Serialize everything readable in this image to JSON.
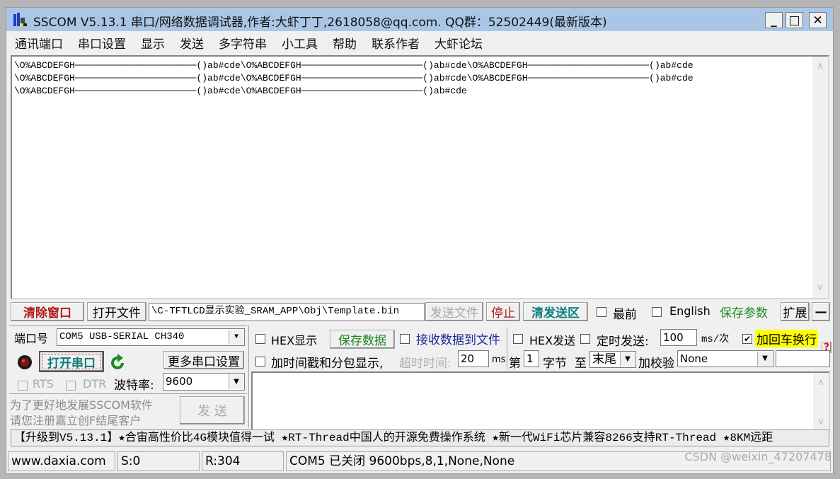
{
  "window": {
    "title": "SSCOM V5.13.1 串口/网络数据调试器,作者:大虾丁丁,2618058@qq.com. QQ群：52502449(最新版本)",
    "minimize_label": "_",
    "maximize_label": "□",
    "close_label": "✕"
  },
  "menu": {
    "items": [
      {
        "label": "通讯端口"
      },
      {
        "label": "串口设置"
      },
      {
        "label": "显示"
      },
      {
        "label": "发送"
      },
      {
        "label": "多字符串"
      },
      {
        "label": "小工具"
      },
      {
        "label": "帮助"
      },
      {
        "label": "联系作者"
      },
      {
        "label": "大虾论坛"
      }
    ]
  },
  "receive": {
    "lines": [
      "\\O%ABCDEFGH──────────────────────()ab#cde\\O%ABCDEFGH──────────────────────()ab#cde\\O%ABCDEFGH──────────────────────()ab#cde",
      "\\O%ABCDEFGH──────────────────────()ab#cde\\O%ABCDEFGH──────────────────────()ab#cde\\O%ABCDEFGH──────────────────────()ab#cde",
      "\\O%ABCDEFGH──────────────────────()ab#cde\\O%ABCDEFGH──────────────────────()ab#cde"
    ],
    "scroll_up": "∧",
    "scroll_down": "∨"
  },
  "toolbar": {
    "clear_window": "清除窗口",
    "open_file": "打开文件",
    "file_path": "\\C-TFTLCD显示实验_SRAM_APP\\Obj\\Template.bin",
    "send_file": "发送文件",
    "stop": "停止",
    "clear_send": "清发送区",
    "topmost_label": "最前",
    "topmost_checked": false,
    "english_label": "English",
    "english_checked": false,
    "save_params": "保存参数",
    "expand": "扩展",
    "collapse": "—"
  },
  "port": {
    "port_label": "端口号",
    "port_value": "COM5 USB-SERIAL CH340",
    "open_port": "打开串口",
    "more_settings": "更多串口设置",
    "rts_label": "RTS",
    "dtr_label": "DTR",
    "baud_label": "波特率:",
    "baud_value": "9600",
    "promo_line1": "为了更好地发展SSCOM软件",
    "promo_line2": "请您注册嘉立创F结尾客户",
    "send_button": "发  送"
  },
  "options": {
    "hex_display": "HEX显示",
    "hex_display_checked": false,
    "save_data": "保存数据",
    "recv_to_file": "接收数据到文件",
    "recv_to_file_checked": false,
    "hex_send": "HEX发送",
    "hex_send_checked": false,
    "timed_send": "定时发送:",
    "timed_send_checked": false,
    "interval_value": "100",
    "interval_unit": "ms/次",
    "add_crlf": "加回车换行",
    "add_crlf_checked": true,
    "help_icon": "?",
    "timestamp": "加时间戳和分包显示,",
    "timestamp_checked": false,
    "timeout_label": "超时时间:",
    "timeout_value": "20",
    "timeout_unit": "ms",
    "byte_from_label": "第",
    "byte_from_value": "1",
    "byte_unit": "字节",
    "to_label": "至",
    "to_value": "末尾",
    "checksum_label": "加校验",
    "checksum_value": "None"
  },
  "ticker": {
    "text": "【升级到V5.13.1】★合宙高性价比4G模块值得一试 ★RT-Thread中国人的开源免费操作系统 ★新一代WiFi芯片兼容8266支持RT-Thread ★8KM远距"
  },
  "statusbar": {
    "website": "www.daxia.com",
    "sent": "S:0",
    "received": "R:304",
    "port_status": "COM5 已关闭  9600bps,8,1,None,None"
  },
  "watermark": "CSDN @weixin_47207478"
}
